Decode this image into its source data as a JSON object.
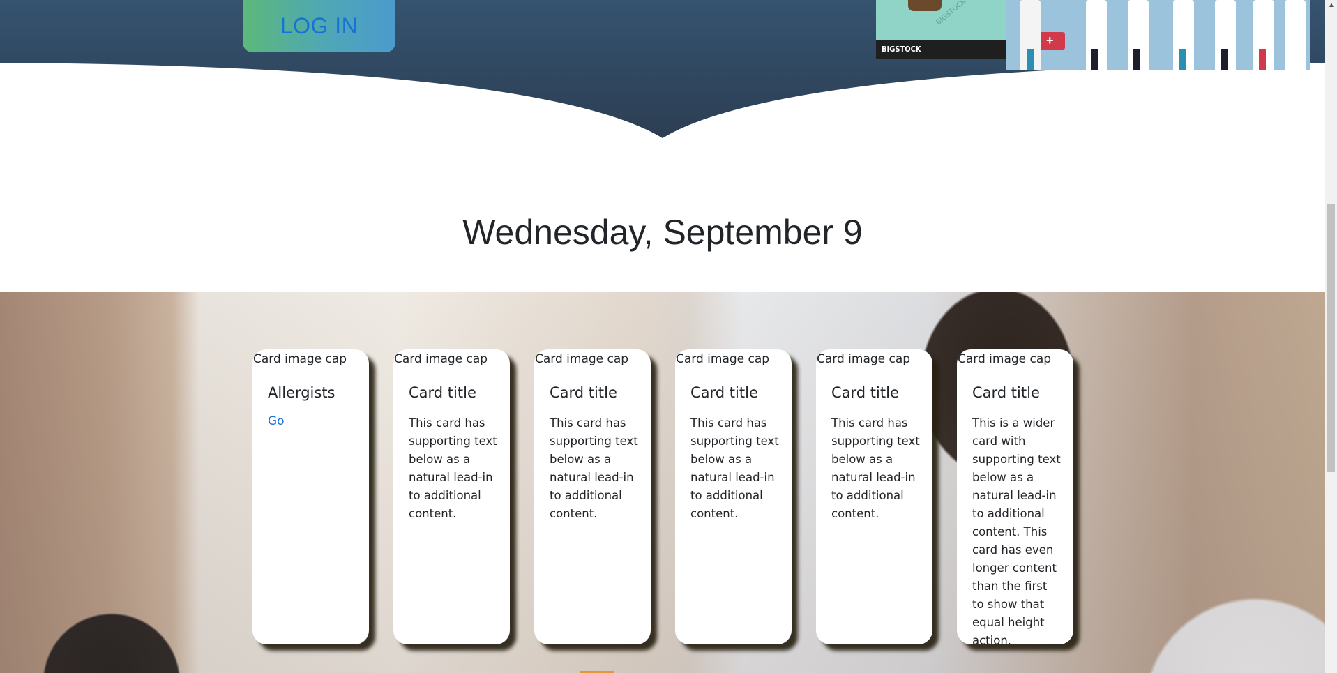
{
  "hero": {
    "login_label": "LOG IN",
    "thumb_caption": "BIGSTOCK",
    "thumb_watermark": "BIGSTOCK"
  },
  "date_heading": "Wednesday, September 9",
  "cards": [
    {
      "cap": "Card image cap",
      "title": "Allergists",
      "link": "Go"
    },
    {
      "cap": "Card image cap",
      "title": "Card title",
      "text": "This card has supporting text below as a natural lead-in to additional content."
    },
    {
      "cap": "Card image cap",
      "title": "Card title",
      "text": "This card has supporting text below as a natural lead-in to additional content."
    },
    {
      "cap": "Card image cap",
      "title": "Card title",
      "text": "This card has supporting text below as a natural lead-in to additional content."
    },
    {
      "cap": "Card image cap",
      "title": "Card title",
      "text": "This card has supporting text below as a natural lead-in to additional content."
    },
    {
      "cap": "Card image cap",
      "title": "Card title",
      "text": "This is a wider card with supporting text below as a natural lead-in to additional content. This card has even longer content than the first to show that equal height action."
    }
  ],
  "colors": {
    "hero_top": "#35536f",
    "hero_bottom": "#2c3e53",
    "link": "#1573d6",
    "card_shadow": "#28220f"
  }
}
